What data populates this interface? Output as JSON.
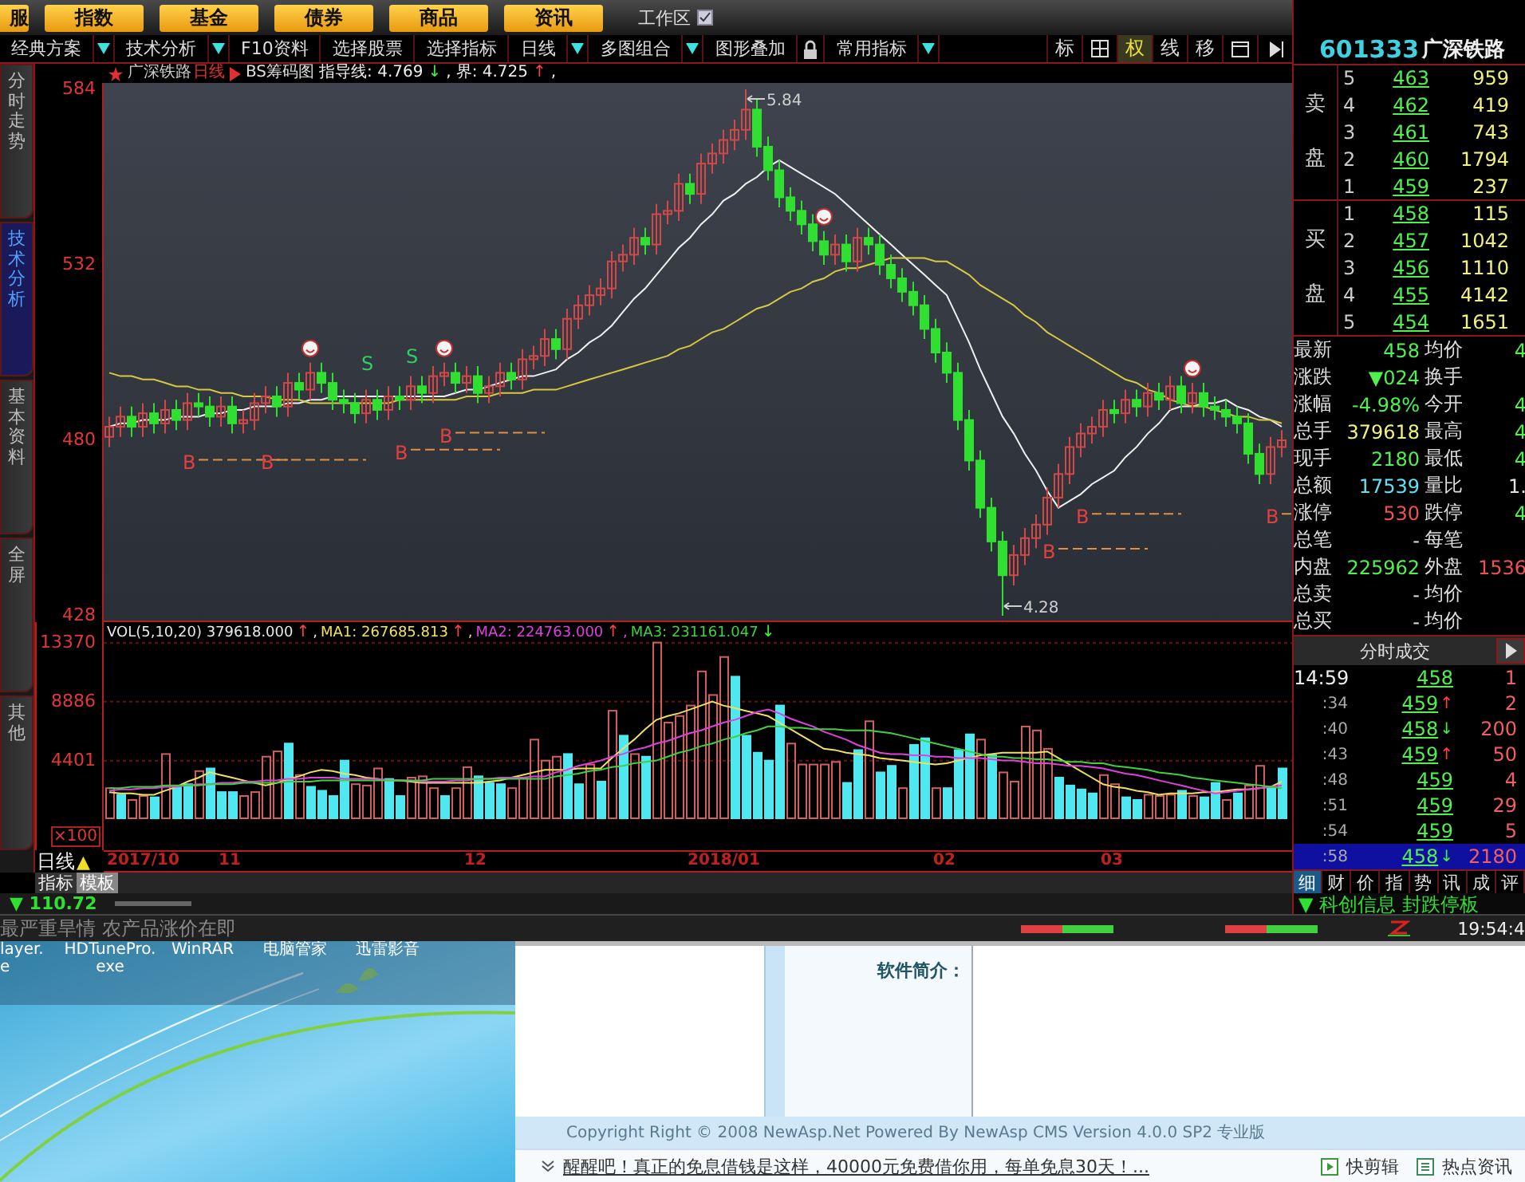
{
  "top_menu": {
    "buttons": [
      {
        "label": "服"
      },
      {
        "label": "指数"
      },
      {
        "label": "基金"
      },
      {
        "label": "债券"
      },
      {
        "label": "商品"
      },
      {
        "label": "资讯"
      }
    ],
    "workspace": "工作区"
  },
  "toolbar": {
    "items": [
      {
        "label": "经典方案",
        "dropdown": true
      },
      {
        "label": "技术分析",
        "dropdown": true
      },
      {
        "label": "F10资料",
        "dropdown": false
      },
      {
        "label": "选择股票",
        "dropdown": false
      },
      {
        "label": "选择指标",
        "dropdown": false
      },
      {
        "label": "日线",
        "dropdown": true
      },
      {
        "label": "多图组合",
        "dropdown": true
      },
      {
        "label": "图形叠加",
        "dropdown": false
      },
      {
        "label": "常用指标",
        "dropdown": true
      }
    ],
    "right_tools": [
      {
        "label": "标",
        "selected": false
      },
      {
        "label": "权",
        "selected": true
      },
      {
        "label": "线",
        "selected": false
      },
      {
        "label": "移",
        "selected": false
      }
    ]
  },
  "side_tabs": [
    {
      "label": "分时走势",
      "selected": false
    },
    {
      "label": "技术分析",
      "selected": true
    },
    {
      "label": "基本资料",
      "selected": false
    },
    {
      "label": "全屏",
      "selected": false
    },
    {
      "label": "其他",
      "selected": false
    }
  ],
  "chart": {
    "stock": "广深铁路",
    "period": "日线",
    "indicator": "BS筹码图",
    "guides": [
      {
        "text": "指导线: 4.769",
        "arrow": "↓",
        "rising": false,
        "suffix": ","
      },
      {
        "text": "界: 4.725",
        "arrow": "↑",
        "rising": true,
        "suffix": ","
      }
    ],
    "annotations": [
      {
        "kind": "high",
        "text": "5.84"
      },
      {
        "kind": "low",
        "text": "4.28"
      }
    ],
    "markers": [
      {
        "kind": "buy",
        "label": "B"
      },
      {
        "kind": "buy",
        "label": "B"
      },
      {
        "kind": "sell",
        "label": "S"
      },
      {
        "kind": "buy",
        "label": "B"
      },
      {
        "kind": "sell",
        "label": "S"
      },
      {
        "kind": "buy",
        "label": "B"
      },
      {
        "kind": "buy",
        "label": "B"
      },
      {
        "kind": "buy",
        "label": "B"
      },
      {
        "kind": "buy",
        "label": "B"
      }
    ],
    "chart_data": {
      "type": "candlestick",
      "ylim": [
        428,
        584
      ],
      "yticks": [
        428,
        480,
        532,
        584
      ],
      "ohlc": [
        [
          481,
          487,
          478,
          484
        ],
        [
          484,
          490,
          481,
          487
        ],
        [
          487,
          490,
          481,
          484
        ],
        [
          484,
          491,
          481,
          488
        ],
        [
          488,
          491,
          482,
          485
        ],
        [
          485,
          492,
          482,
          489
        ],
        [
          489,
          492,
          483,
          486
        ],
        [
          486,
          494,
          483,
          491
        ],
        [
          491,
          494,
          487,
          490
        ],
        [
          490,
          493,
          484,
          487
        ],
        [
          487,
          493,
          484,
          490
        ],
        [
          490,
          493,
          482,
          485
        ],
        [
          485,
          489,
          482,
          486
        ],
        [
          486,
          494,
          483,
          491
        ],
        [
          491,
          496,
          488,
          493
        ],
        [
          493,
          496,
          487,
          490
        ],
        [
          490,
          500,
          487,
          497
        ],
        [
          497,
          500,
          492,
          495
        ],
        [
          495,
          503,
          492,
          500
        ],
        [
          500,
          503,
          494,
          497
        ],
        [
          497,
          500,
          489,
          492
        ],
        [
          492,
          495,
          488,
          491
        ],
        [
          491,
          494,
          485,
          488
        ],
        [
          488,
          495,
          485,
          492
        ],
        [
          492,
          495,
          486,
          489
        ],
        [
          489,
          496,
          486,
          493
        ],
        [
          493,
          496,
          489,
          492
        ],
        [
          492,
          499,
          489,
          496
        ],
        [
          496,
          499,
          491,
          494
        ],
        [
          494,
          502,
          491,
          499
        ],
        [
          499,
          503,
          496,
          500
        ],
        [
          500,
          503,
          494,
          497
        ],
        [
          497,
          502,
          494,
          499
        ],
        [
          499,
          502,
          491,
          494
        ],
        [
          494,
          499,
          491,
          496
        ],
        [
          496,
          503,
          493,
          500
        ],
        [
          500,
          503,
          495,
          498
        ],
        [
          498,
          507,
          495,
          504
        ],
        [
          504,
          508,
          501,
          505
        ],
        [
          505,
          513,
          502,
          510
        ],
        [
          510,
          513,
          504,
          507
        ],
        [
          507,
          519,
          504,
          516
        ],
        [
          516,
          523,
          513,
          520
        ],
        [
          520,
          526,
          517,
          523
        ],
        [
          523,
          528,
          520,
          525
        ],
        [
          525,
          536,
          522,
          533
        ],
        [
          533,
          538,
          530,
          535
        ],
        [
          535,
          543,
          532,
          540
        ],
        [
          540,
          543,
          535,
          538
        ],
        [
          538,
          550,
          535,
          547
        ],
        [
          547,
          551,
          544,
          548
        ],
        [
          548,
          559,
          545,
          556
        ],
        [
          556,
          559,
          550,
          553
        ],
        [
          553,
          565,
          550,
          562
        ],
        [
          562,
          568,
          559,
          565
        ],
        [
          565,
          572,
          562,
          569
        ],
        [
          569,
          575,
          566,
          572
        ],
        [
          572,
          584,
          569,
          578
        ],
        [
          578,
          581,
          564,
          567
        ],
        [
          567,
          570,
          557,
          560
        ],
        [
          560,
          563,
          549,
          552
        ],
        [
          552,
          555,
          545,
          548
        ],
        [
          548,
          551,
          541,
          544
        ],
        [
          544,
          547,
          536,
          539
        ],
        [
          539,
          542,
          532,
          535
        ],
        [
          535,
          541,
          532,
          538
        ],
        [
          538,
          541,
          530,
          533
        ],
        [
          533,
          543,
          530,
          540
        ],
        [
          540,
          543,
          535,
          538
        ],
        [
          538,
          541,
          529,
          532
        ],
        [
          532,
          535,
          525,
          528
        ],
        [
          528,
          531,
          521,
          524
        ],
        [
          524,
          527,
          517,
          520
        ],
        [
          520,
          523,
          510,
          513
        ],
        [
          513,
          516,
          503,
          506
        ],
        [
          506,
          509,
          497,
          500
        ],
        [
          500,
          503,
          483,
          486
        ],
        [
          486,
          489,
          471,
          474
        ],
        [
          474,
          477,
          457,
          460
        ],
        [
          460,
          463,
          447,
          450
        ],
        [
          450,
          453,
          428,
          440
        ],
        [
          440,
          449,
          437,
          446
        ],
        [
          446,
          454,
          443,
          451
        ],
        [
          451,
          458,
          448,
          455
        ],
        [
          455,
          466,
          452,
          463
        ],
        [
          463,
          473,
          460,
          470
        ],
        [
          470,
          481,
          467,
          478
        ],
        [
          478,
          485,
          475,
          482
        ],
        [
          482,
          487,
          479,
          484
        ],
        [
          484,
          492,
          481,
          489
        ],
        [
          489,
          492,
          485,
          488
        ],
        [
          488,
          495,
          485,
          492
        ],
        [
          492,
          495,
          487,
          490
        ],
        [
          490,
          497,
          487,
          494
        ],
        [
          494,
          497,
          489,
          492
        ],
        [
          492,
          499,
          489,
          496
        ],
        [
          496,
          499,
          488,
          491
        ],
        [
          491,
          497,
          488,
          494
        ],
        [
          494,
          497,
          487,
          490
        ],
        [
          490,
          493,
          486,
          489
        ],
        [
          489,
          492,
          484,
          487
        ],
        [
          487,
          490,
          482,
          485
        ],
        [
          485,
          488,
          473,
          476
        ],
        [
          476,
          479,
          467,
          470
        ],
        [
          470,
          481,
          467,
          478
        ],
        [
          478,
          483,
          475,
          480
        ]
      ],
      "series": [
        {
          "type": "line",
          "color": "#f0f0f0",
          "values": [
            484,
            485,
            485,
            486,
            486,
            486,
            487,
            487,
            487,
            488,
            488,
            489,
            489,
            490,
            490,
            490,
            491,
            491,
            492,
            492,
            493,
            493,
            493,
            493,
            493,
            493,
            493,
            493,
            493,
            493,
            493,
            494,
            495,
            495,
            496,
            497,
            498,
            499,
            499,
            500,
            501,
            504,
            506,
            509,
            511,
            514,
            518,
            522,
            525,
            529,
            533,
            537,
            540,
            544,
            547,
            551,
            553,
            556,
            558,
            561,
            563,
            561,
            559,
            557,
            555,
            553,
            550,
            547,
            544,
            541,
            538,
            535,
            532,
            529,
            526,
            523,
            516,
            509,
            501,
            494,
            487,
            482,
            476,
            471,
            465,
            460,
            462,
            464,
            467,
            469,
            471,
            475,
            478,
            482,
            485,
            489,
            490,
            490,
            491,
            491,
            492,
            490,
            489,
            487,
            486,
            484
          ]
        },
        {
          "type": "line",
          "color": "#d8c840",
          "values": [
            500,
            499,
            499,
            498,
            498,
            497,
            496,
            496,
            495,
            495,
            494,
            494,
            493,
            493,
            493,
            492,
            492,
            492,
            491,
            491,
            491,
            491,
            491,
            491,
            491,
            491,
            492,
            492,
            492,
            492,
            492,
            492,
            493,
            493,
            493,
            494,
            494,
            494,
            495,
            495,
            495,
            496,
            497,
            498,
            499,
            500,
            501,
            502,
            503,
            504,
            505,
            507,
            508,
            510,
            512,
            513,
            515,
            517,
            519,
            520,
            522,
            524,
            525,
            527,
            528,
            530,
            531,
            531,
            532,
            533,
            534,
            534,
            534,
            534,
            533,
            533,
            531,
            529,
            526,
            524,
            522,
            520,
            517,
            515,
            512,
            510,
            508,
            506,
            504,
            502,
            500,
            498,
            497,
            495,
            494,
            492,
            491,
            490,
            490,
            489,
            488,
            487,
            487,
            486,
            486,
            485
          ]
        }
      ]
    }
  },
  "volume": {
    "legend": [
      {
        "text": "VOL(5,10,20) 379618.000",
        "arrow": "↑",
        "rising": true,
        "suffix": ",",
        "color": "#e8e8e8"
      },
      {
        "text": "MA1: 267685.813",
        "arrow": "↑",
        "rising": true,
        "suffix": ",",
        "color": "#f0e060"
      },
      {
        "text": "MA2: 224763.000",
        "arrow": "↑",
        "rising": true,
        "suffix": ",",
        "color": "#e040e0"
      },
      {
        "text": "MA3: 231161.047",
        "arrow": "↓",
        "rising": false,
        "color": "#40d040"
      }
    ],
    "unit": "×100",
    "chart_data": {
      "type": "bar",
      "ylim": [
        0,
        13500
      ],
      "yticks": [
        4401,
        8886,
        13370
      ],
      "series": [
        {
          "color": "#d06060",
          "values": [
            2300,
            null,
            1400,
            1700,
            null,
            4900,
            null,
            null,
            3600,
            null,
            null,
            null,
            1700,
            2000,
            4700,
            5100,
            null,
            3300,
            null,
            null,
            null,
            null,
            2600,
            2500,
            3800,
            null,
            null,
            3100,
            3200,
            2300,
            null,
            2300,
            3900,
            null,
            null,
            null,
            2300,
            3100,
            6000,
            4400,
            4700,
            null,
            null,
            4100,
            null,
            8200,
            null,
            4900,
            null,
            13400,
            7300,
            7800,
            8600,
            11200,
            9400,
            12300,
            null,
            null,
            null,
            null,
            null,
            5700,
            4100,
            4100,
            4100,
            4300,
            null,
            null,
            7400,
            null,
            null,
            2300,
            null,
            null,
            2300,
            null,
            null,
            null,
            6000,
            null,
            3500,
            2800,
            7000,
            6700,
            5300,
            null,
            null,
            null,
            null,
            3300,
            2600,
            null,
            null,
            1800,
            1700,
            1800,
            null,
            1700,
            null,
            null,
            1400,
            null,
            2500,
            4000,
            null,
            null
          ]
        },
        {
          "color": "#50e8f0",
          "values": [
            null,
            1800,
            null,
            null,
            1600,
            null,
            2400,
            2600,
            null,
            3800,
            2000,
            2000,
            null,
            null,
            null,
            null,
            5700,
            null,
            2400,
            2100,
            1700,
            4400,
            null,
            null,
            null,
            3000,
            1700,
            null,
            null,
            null,
            1700,
            null,
            null,
            3200,
            2700,
            2600,
            null,
            null,
            null,
            null,
            null,
            4900,
            2600,
            null,
            2800,
            null,
            6300,
            null,
            4700,
            null,
            null,
            null,
            null,
            null,
            null,
            null,
            10800,
            6300,
            5000,
            4400,
            8600,
            null,
            null,
            null,
            null,
            null,
            2700,
            5200,
            null,
            3500,
            4000,
            null,
            5600,
            6100,
            null,
            2300,
            5200,
            6400,
            null,
            4800,
            null,
            null,
            null,
            null,
            null,
            3100,
            2500,
            2200,
            1900,
            null,
            null,
            1600,
            1400,
            null,
            null,
            null,
            2100,
            null,
            1600,
            2700,
            null,
            1900,
            null,
            null,
            2300,
            3800
          ]
        },
        {
          "type": "line",
          "color": "#f0e060",
          "values": [
            2000,
            1900,
            1900,
            1800,
            1800,
            2100,
            2400,
            2800,
            3100,
            3500,
            3300,
            3100,
            2900,
            2700,
            2500,
            2700,
            3000,
            3200,
            3500,
            3700,
            3600,
            3400,
            3300,
            3100,
            3000,
            2900,
            2900,
            2800,
            2700,
            2700,
            2700,
            2700,
            2700,
            2700,
            2800,
            2900,
            3100,
            3300,
            3500,
            3700,
            3700,
            3700,
            3800,
            3800,
            3800,
            4600,
            5300,
            6000,
            6800,
            7500,
            7800,
            8000,
            8300,
            8600,
            8900,
            8600,
            8400,
            8200,
            8000,
            7800,
            7300,
            6800,
            6300,
            5800,
            5300,
            5200,
            5000,
            4900,
            4800,
            4600,
            4500,
            4400,
            4300,
            4200,
            4100,
            4200,
            4400,
            4600,
            4800,
            4900,
            5000,
            5000,
            5000,
            5000,
            5100,
            4600,
            4100,
            3600,
            3100,
            2600,
            2400,
            2300,
            2100,
            2000,
            1800,
            1900,
            1900,
            1900,
            2000,
            2000,
            2100,
            2200,
            2200,
            2300,
            2400,
            2800
          ]
        },
        {
          "type": "line",
          "color": "#e040e0",
          "values": [
            2100,
            2200,
            2200,
            2300,
            2300,
            2400,
            2400,
            2500,
            2600,
            2600,
            2700,
            2700,
            2800,
            2800,
            2900,
            2900,
            3000,
            3000,
            3100,
            3100,
            3100,
            3000,
            3000,
            3000,
            3000,
            2900,
            2900,
            2900,
            2800,
            2800,
            2800,
            2900,
            2900,
            3000,
            3000,
            3100,
            3100,
            3100,
            3200,
            3200,
            3500,
            3700,
            4000,
            4200,
            4400,
            4700,
            4900,
            5200,
            5400,
            5700,
            5900,
            6200,
            6500,
            6700,
            7000,
            7300,
            7500,
            7800,
            8100,
            8300,
            8000,
            7600,
            7300,
            7000,
            6600,
            6300,
            6000,
            5600,
            5300,
            5000,
            4900,
            4900,
            4800,
            4800,
            4700,
            4700,
            4600,
            4600,
            4600,
            4500,
            4400,
            4400,
            4300,
            4200,
            4200,
            4100,
            4000,
            4000,
            3900,
            3800,
            3600,
            3400,
            3300,
            3100,
            2900,
            2700,
            2500,
            2300,
            2100,
            1900,
            2000,
            2100,
            2200,
            2300,
            2400,
            2500
          ]
        },
        {
          "type": "line",
          "color": "#40d040",
          "values": [
            2300,
            2300,
            2400,
            2400,
            2400,
            2500,
            2500,
            2500,
            2500,
            2600,
            2600,
            2600,
            2700,
            2700,
            2700,
            2700,
            2800,
            2800,
            2800,
            2900,
            2900,
            2900,
            2900,
            2900,
            2900,
            2900,
            2900,
            2900,
            2900,
            3000,
            3000,
            3000,
            3000,
            3000,
            3000,
            3000,
            3000,
            3000,
            3000,
            3000,
            3200,
            3300,
            3400,
            3600,
            3700,
            3900,
            4000,
            4200,
            4300,
            4400,
            4700,
            5000,
            5200,
            5500,
            5700,
            6000,
            6200,
            6500,
            6700,
            7000,
            7000,
            6900,
            6900,
            6800,
            6800,
            6800,
            6700,
            6700,
            6700,
            6600,
            6500,
            6300,
            6100,
            5900,
            5700,
            5500,
            5300,
            5100,
            4900,
            4700,
            4700,
            4600,
            4600,
            4500,
            4500,
            4400,
            4300,
            4300,
            4200,
            4200,
            4000,
            3900,
            3800,
            3700,
            3500,
            3400,
            3300,
            3100,
            3000,
            2900,
            2800,
            2700,
            2600,
            2500,
            2400,
            2300
          ]
        }
      ]
    },
    "date_labels": [
      "2017/10",
      "11",
      "12",
      "2018/01",
      "02",
      "03"
    ]
  },
  "period_bar": {
    "label": "日线",
    "marker": "▲",
    "tabs": [
      {
        "label": "指标",
        "selected": false
      },
      {
        "label": "模板",
        "selected": true
      }
    ]
  },
  "index_status": "▼ 110.72",
  "news_ticker": "最严重旱情 农产品涨价在即",
  "quote": {
    "code": "601333",
    "name": "广深铁路",
    "sell_label": "卖盘",
    "buy_label": "买盘",
    "sell": [
      {
        "rank": "5",
        "price": "463",
        "volume": "959"
      },
      {
        "rank": "4",
        "price": "462",
        "volume": "419"
      },
      {
        "rank": "3",
        "price": "461",
        "volume": "743"
      },
      {
        "rank": "2",
        "price": "460",
        "volume": "1794"
      },
      {
        "rank": "1",
        "price": "459",
        "volume": "237"
      }
    ],
    "buy": [
      {
        "rank": "1",
        "price": "458",
        "volume": "115"
      },
      {
        "rank": "2",
        "price": "457",
        "volume": "1042"
      },
      {
        "rank": "3",
        "price": "456",
        "volume": "1110"
      },
      {
        "rank": "4",
        "price": "455",
        "volume": "4142"
      },
      {
        "rank": "5",
        "price": "454",
        "volume": "1651"
      }
    ],
    "stats": [
      {
        "cells": [
          {
            "label": "最新",
            "value": "458",
            "color": "#50f050"
          },
          {
            "label": "均价",
            "value": "4",
            "color": "#50f050"
          }
        ]
      },
      {
        "cells": [
          {
            "label": "涨跌",
            "value": "▼024",
            "color": "#50f050"
          },
          {
            "label": "换手"
          }
        ]
      },
      {
        "cells": [
          {
            "label": "涨幅",
            "value": "-4.98%",
            "color": "#50f050"
          },
          {
            "label": "今开",
            "value": "4",
            "color": "#50f050"
          }
        ]
      },
      {
        "cells": [
          {
            "label": "总手",
            "value": "379618",
            "color": "#f0f080"
          },
          {
            "label": "最高",
            "value": "4",
            "color": "#50f050"
          }
        ]
      },
      {
        "cells": [
          {
            "label": "现手",
            "value": "2180",
            "color": "#50f050"
          },
          {
            "label": "最低",
            "value": "4",
            "color": "#50f050"
          }
        ]
      },
      {
        "cells": [
          {
            "label": "总额",
            "value": "17539",
            "color": "#60e0f0"
          },
          {
            "label": "量比",
            "value": "1.",
            "color": "#e0e0e0"
          }
        ]
      },
      {
        "cells": [
          {
            "label": "涨停",
            "value": "530",
            "color": "#f05050"
          },
          {
            "label": "跌停",
            "value": "4",
            "color": "#50f050"
          }
        ]
      },
      {
        "cells": [
          {
            "label": "总笔",
            "value": "-",
            "color": "#e0e0e0"
          },
          {
            "label": "每笔"
          }
        ]
      },
      {
        "cells": [
          {
            "label": "内盘",
            "value": "225962",
            "color": "#50f050"
          },
          {
            "label": "外盘",
            "value": "1536",
            "color": "#f05050"
          }
        ]
      },
      {
        "cells": [
          {
            "label": "总卖",
            "value": "-",
            "color": "#e0e0e0"
          },
          {
            "label": "均价"
          }
        ]
      },
      {
        "cells": [
          {
            "label": "总买",
            "value": "-",
            "color": "#e0e0e0"
          },
          {
            "label": "均价"
          }
        ]
      }
    ]
  },
  "trades": {
    "title": "分时成交",
    "rows": [
      {
        "time": "14:59",
        "price": "458",
        "volume": "1",
        "selected": false
      },
      {
        "time": ":34",
        "price": "459",
        "arrow": "↑",
        "rising": true,
        "volume": "2",
        "selected": false
      },
      {
        "time": ":40",
        "price": "458",
        "arrow": "↓",
        "rising": false,
        "volume": "200",
        "selected": false
      },
      {
        "time": ":43",
        "price": "459",
        "arrow": "↑",
        "rising": true,
        "volume": "50",
        "selected": false
      },
      {
        "time": ":48",
        "price": "459",
        "volume": "4",
        "selected": false
      },
      {
        "time": ":51",
        "price": "459",
        "volume": "29",
        "selected": false
      },
      {
        "time": ":54",
        "price": "459",
        "volume": "5",
        "selected": false
      },
      {
        "time": ":58",
        "price": "458",
        "arrow": "↓",
        "rising": false,
        "volume": "2180",
        "selected": true
      }
    ]
  },
  "info_tabs": [
    {
      "label": "细",
      "selected": true
    },
    {
      "label": "财",
      "selected": false
    },
    {
      "label": "价",
      "selected": false
    },
    {
      "label": "指",
      "selected": false
    },
    {
      "label": "势",
      "selected": false
    },
    {
      "label": "讯",
      "selected": false
    },
    {
      "label": "成",
      "selected": false
    },
    {
      "label": "评",
      "selected": false
    }
  ],
  "alert": "▼ 科创信息 封跌停板",
  "clock": "19:54:4",
  "desktop_icons": [
    {
      "lines": [
        "layer.",
        "e"
      ]
    },
    {
      "lines": [
        "HDTunePro.",
        "exe"
      ]
    },
    {
      "lines": [
        "WinRAR"
      ]
    },
    {
      "lines": [
        "电脑管家"
      ]
    },
    {
      "lines": [
        "迅雷影音"
      ]
    }
  ],
  "web_page": {
    "section_label": "软件简介：",
    "copyright": "Copyright Right © 2008 NewAsp.Net Powered By NewAsp CMS Version 4.0.0 SP2 专业版",
    "marquee": "醒醒吧！真正的免息借钱是这样，40000元免费借你用，每单免息30天！...",
    "links": [
      "快剪辑",
      "热点资讯"
    ]
  }
}
